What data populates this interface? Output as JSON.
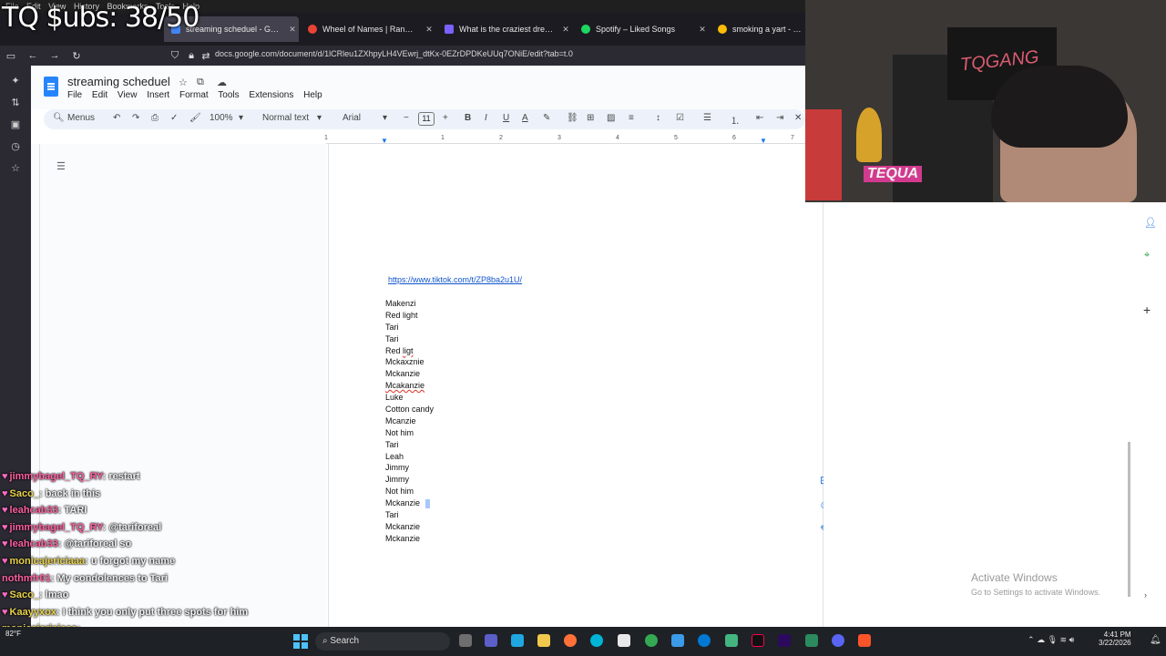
{
  "app_menu": [
    "File",
    "Edit",
    "View",
    "History",
    "Bookmarks",
    "Tools",
    "Help"
  ],
  "overlay": {
    "subs": "TQ $ubs: 38/50"
  },
  "tabs": [
    {
      "label": "streaming scheduel - Google D",
      "active": true,
      "color": "#4285f4"
    },
    {
      "label": "Wheel of Names | Random",
      "active": false,
      "color": "#ea4335"
    },
    {
      "label": "What is the craziest dream you",
      "active": false,
      "color": "#7b61ff"
    },
    {
      "label": "Spotify – Liked Songs",
      "active": false,
      "color": "#1ed760"
    },
    {
      "label": "smoking a yart - Google",
      "active": false,
      "color": "#fbbc05"
    }
  ],
  "url": "docs.google.com/document/d/1lCRleu1ZXhpyLH4VEwrj_dtKx-0EZrDPDKeUUq7ONiE/edit?tab=t.0",
  "doc": {
    "title": "streaming scheduel",
    "menus": [
      "File",
      "Edit",
      "View",
      "Insert",
      "Format",
      "Tools",
      "Extensions",
      "Help"
    ]
  },
  "toolbar": {
    "menus_label": "Menus",
    "zoom": "100%",
    "style": "Normal text",
    "font": "Arial",
    "font_size": "11"
  },
  "ruler_numbers": [
    "1",
    "1",
    "2",
    "3",
    "4",
    "5",
    "6",
    "7"
  ],
  "document": {
    "link": "https://www.tiktok.com/t/ZP8ba2u1U/",
    "lines": [
      {
        "text": "Makenzi"
      },
      {
        "text": "Red light"
      },
      {
        "text": "Tari"
      },
      {
        "text": "Tari"
      },
      {
        "text": "Red ligt",
        "misspelled": "ligt"
      },
      {
        "text": "Mckaxznie"
      },
      {
        "text": "Mckanzie"
      },
      {
        "text": "Mcakanzie",
        "misspelled": "Mcakanzie"
      },
      {
        "text": "Luke"
      },
      {
        "text": "Cotton candy"
      },
      {
        "text": "Mcanzie"
      },
      {
        "text": "Not him"
      },
      {
        "text": "Tari"
      },
      {
        "text": "Leah"
      },
      {
        "text": "Jimmy"
      },
      {
        "text": "Jimmy"
      },
      {
        "text": "Not him"
      },
      {
        "text": "Mckanzie"
      },
      {
        "text": "Tari"
      },
      {
        "text": "Mckanzie"
      },
      {
        "text": "Mckanzie"
      }
    ]
  },
  "activate_windows": {
    "title": "Activate Windows",
    "subtitle": "Go to Settings to activate Windows."
  },
  "webcam": {
    "banner": "TQGANG",
    "sticker": "TEQUA"
  },
  "chat": [
    {
      "user": "jimmybagel_TQ_RY",
      "message": "restart",
      "color": "#ff5fa2"
    },
    {
      "user": "Saco_",
      "message": "back in this",
      "color": "#e8d14a"
    },
    {
      "user": "leahcab33",
      "message": "TARI",
      "color": "#ff5fa2"
    },
    {
      "user": "jimmybagel_TQ_RY",
      "message": "@tariforeal",
      "color": "#ff5fa2"
    },
    {
      "user": "leahcab33",
      "message": "@tariforeal so",
      "color": "#ff5fa2"
    },
    {
      "user": "monicajericiaaa",
      "message": "u forgot my name",
      "color": "#e8d14a"
    },
    {
      "user": "nothmfr01",
      "message": "My condolences to Tari",
      "color": "#ff5fa2"
    },
    {
      "user": "Saco_",
      "message": "lmao",
      "color": "#e8d14a"
    },
    {
      "user": "Kaayyxox",
      "message": "I think you only put three spots for him",
      "color": "#e8d14a"
    },
    {
      "user": "monicajericiaaa",
      "message": "",
      "color": "#e8d14a"
    }
  ],
  "taskbar": {
    "weather": "82°F",
    "search": "Search",
    "time": "4:41 PM",
    "date": "3/22/2026"
  }
}
